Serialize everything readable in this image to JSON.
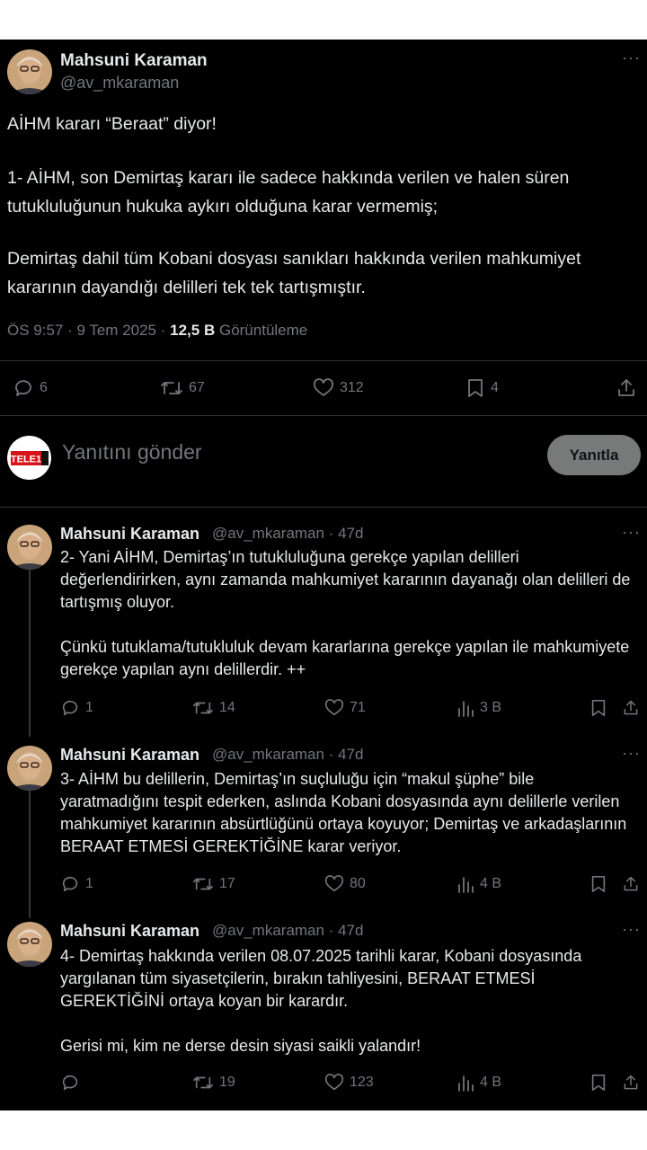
{
  "main_post": {
    "author_name": "Mahsuni Karaman",
    "author_handle": "@av_mkaraman",
    "paragraphs": [
      "AİHM kararı “Beraat” diyor!",
      "1- AİHM, son Demirtaş kararı ile sadece hakkında verilen ve halen süren tutukluluğunun hukuka aykırı olduğuna karar vermemiş;",
      "Demirtaş dahil tüm Kobani dosyası sanıkları hakkında verilen mahkumiyet kararının dayandığı delilleri tek tek tartışmıştır."
    ],
    "timestamp": "ÖS 9:57 · 9 Tem 2025",
    "views_count": "12,5 B",
    "views_label": "Görüntüleme",
    "replies": "6",
    "reposts": "67",
    "likes": "312",
    "bookmarks": "4"
  },
  "composer": {
    "avatar_label": "TELE1",
    "placeholder": "Yanıtını gönder",
    "button_label": "Yanıtla"
  },
  "replies": [
    {
      "author_name": "Mahsuni Karaman",
      "author_meta": "@av_mkaraman · 47d",
      "paragraphs": [
        "2- Yani AİHM, Demirtaş’ın tutukluluğuna gerekçe yapılan delilleri değerlendirirken, aynı zamanda mahkumiyet kararının  dayanağı olan delilleri de tartışmış oluyor.",
        "Çünkü tutuklama/tutukluluk devam kararlarına gerekçe yapılan ile mahkumiyete gerekçe yapılan aynı delillerdir. ++"
      ],
      "replies": "1",
      "reposts": "14",
      "likes": "71",
      "views": "3 B"
    },
    {
      "author_name": "Mahsuni Karaman",
      "author_meta": "@av_mkaraman · 47d",
      "paragraphs": [
        "3- AİHM bu delillerin, Demirtaş’ın  suçluluğu için “makul şüphe” bile yaratmadığını tespit ederken, aslında Kobani dosyasında aynı delillerle verilen mahkumiyet kararının absürtlüğünü ortaya koyuyor; Demirtaş ve arkadaşlarının BERAAT ETMESİ GEREKTİĞİNE karar veriyor."
      ],
      "replies": "1",
      "reposts": "17",
      "likes": "80",
      "views": "4 B"
    },
    {
      "author_name": "Mahsuni Karaman",
      "author_meta": "@av_mkaraman · 47d",
      "paragraphs": [
        "4- Demirtaş hakkında verilen 08.07.2025 tarihli karar, Kobani dosyasında yargılanan tüm siyasetçilerin, bırakın tahliyesini, BERAAT ETMESİ GEREKTİĞİNİ ortaya koyan bir karardır.",
        "Gerisi mi, kim ne derse desin siyasi saikli yalandır!"
      ],
      "replies": "",
      "reposts": "19",
      "likes": "123",
      "views": "4 B"
    }
  ],
  "more_glyph": "···",
  "colors": {
    "background": "#000000",
    "text": "#e7e9ea",
    "muted": "#71767b",
    "divider": "#2f3336",
    "button": "#787a7a",
    "brand_red": "#d7141a"
  },
  "icons": [
    "reply-icon",
    "repost-icon",
    "like-icon",
    "views-icon",
    "bookmark-icon",
    "share-icon",
    "more-icon"
  ]
}
